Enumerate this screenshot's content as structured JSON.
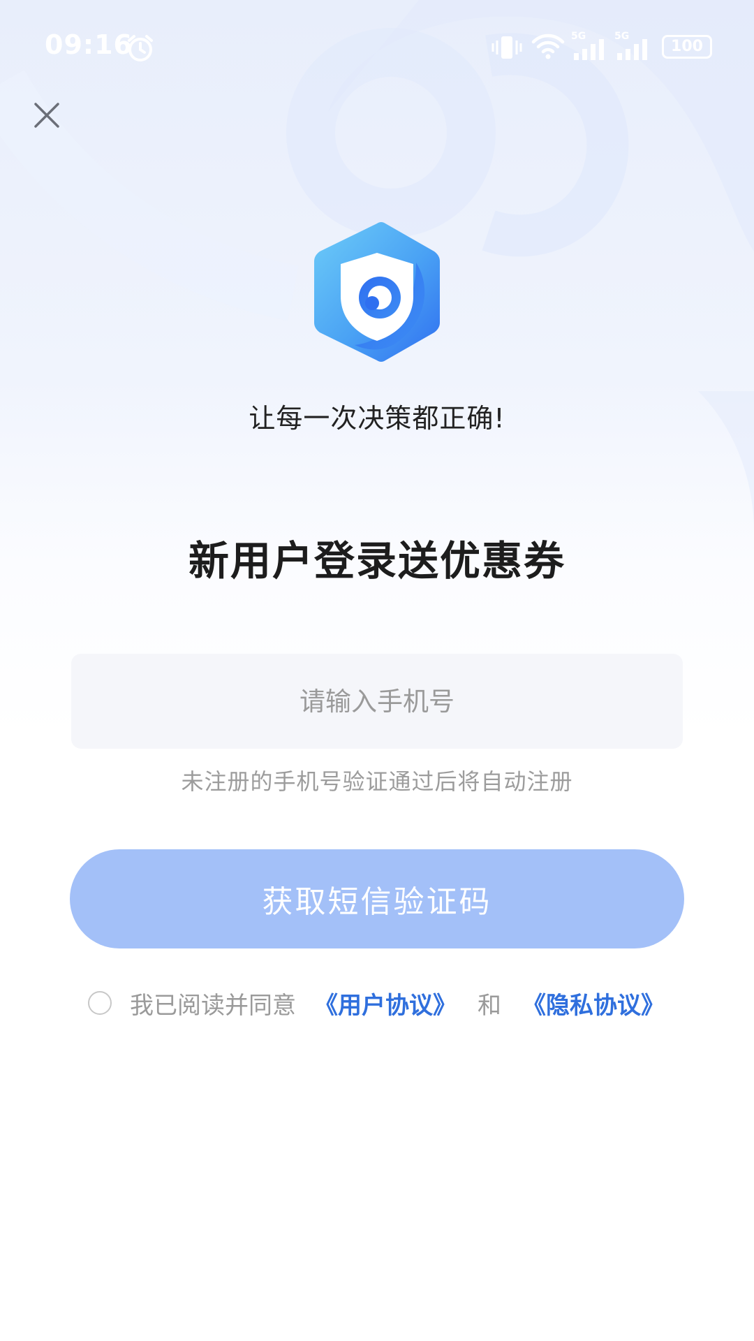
{
  "status_bar": {
    "time": "09:16",
    "battery": "100",
    "signal_label_1": "5G",
    "signal_label_2": "5G",
    "icons": [
      "alarm-icon",
      "vibrate-icon",
      "wifi-icon",
      "signal-icon",
      "signal-icon",
      "battery-icon"
    ]
  },
  "header": {
    "close_icon": "close-icon"
  },
  "brand": {
    "logo_icon": "eye-shield-hexagon-logo",
    "slogan": "让每一次决策都正确!"
  },
  "headline": "新用户登录送优惠券",
  "login_form": {
    "phone_value": "",
    "phone_placeholder": "请输入手机号",
    "hint": "未注册的手机号验证通过后将自动注册",
    "sms_button_label": "获取短信验证码"
  },
  "agreement": {
    "checked": false,
    "prefix": "我已阅读并同意",
    "user_agreement": "《用户协议》",
    "and": "和",
    "privacy_policy": "《隐私协议》"
  },
  "colors": {
    "accent": "#2f6fdd",
    "button_disabled": "#a3c0f8",
    "logo_light": "#66c6f7",
    "logo_dark": "#2f6ff0"
  }
}
